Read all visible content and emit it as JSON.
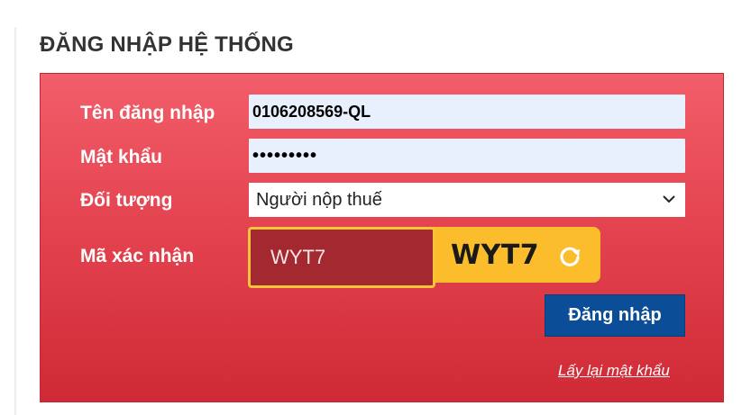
{
  "page": {
    "title": "ĐĂNG NHẬP HỆ THỐNG"
  },
  "form": {
    "username_label": "Tên đăng nhập",
    "username_value": "0106208569-QL",
    "password_label": "Mật khẩu",
    "password_value": "•••••••••",
    "subject_label": "Đối tượng",
    "subject_selected": "Người nộp thuế",
    "captcha_label": "Mã xác nhận",
    "captcha_input_value": "WYT7",
    "captcha_image_text": "WYT7",
    "login_button": "Đăng nhập",
    "forgot_password_link": "Lấy lại mật khẩu"
  },
  "colors": {
    "panel_top": "#f25e6a",
    "panel_bottom": "#cf2a36",
    "button_blue": "#0b4e97",
    "captcha_yellow": "#fbbd2c",
    "captcha_input_bg": "#a3282f"
  },
  "icons": {
    "select_arrow": "chevron-down-icon",
    "captcha_refresh": "refresh-icon"
  }
}
